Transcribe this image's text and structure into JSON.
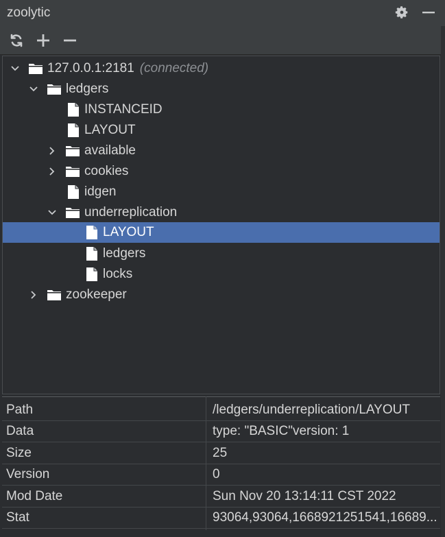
{
  "window": {
    "title": "zoolytic"
  },
  "toolbar": {
    "icons": [
      "refresh-icon",
      "plus-icon",
      "minus-icon"
    ]
  },
  "tree": {
    "root_label": "127.0.0.1:2181",
    "root_status": "(connected)",
    "nodes": [
      "ledgers",
      "INSTANCEID",
      "LAYOUT",
      "available",
      "cookies",
      "idgen",
      "underreplication",
      "LAYOUT",
      "ledgers",
      "locks",
      "zookeeper"
    ]
  },
  "properties": {
    "rows": [
      {
        "key": "Path",
        "value": "/ledgers/underreplication/LAYOUT"
      },
      {
        "key": "Data",
        "value": "type: \"BASIC\"version: 1"
      },
      {
        "key": "Size",
        "value": "25"
      },
      {
        "key": "Version",
        "value": "0"
      },
      {
        "key": "Mod Date",
        "value": "Sun Nov 20 13:14:11 CST 2022"
      },
      {
        "key": "Stat",
        "value": "93064,93064,1668921251541,16689..."
      }
    ]
  },
  "colors": {
    "selection": "#4a6ead",
    "background": "#2b2d30",
    "header": "#3c3f41"
  }
}
